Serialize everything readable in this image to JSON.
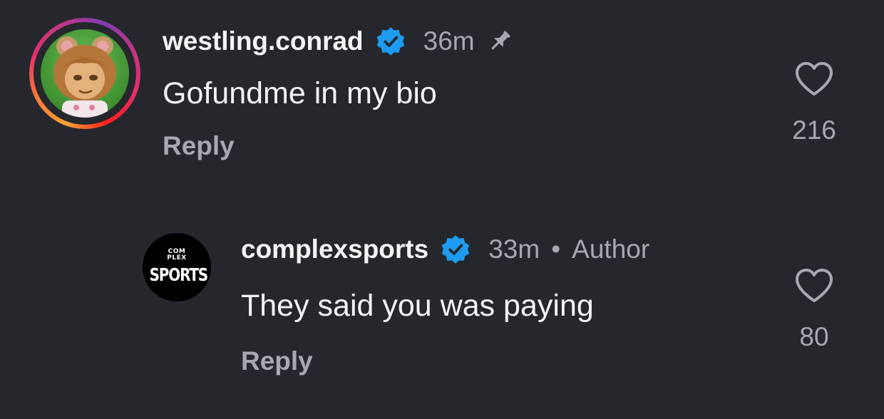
{
  "comments": [
    {
      "username": "westling.conrad",
      "time": "36m",
      "text": "Gofundme in my bio",
      "reply_label": "Reply",
      "likes": "216",
      "pinned": true,
      "verified": true
    },
    {
      "username": "complexsports",
      "time": "33m",
      "separator": "•",
      "badge_label": "Author",
      "text": "They said you was paying",
      "reply_label": "Reply",
      "likes": "80",
      "verified": true,
      "avatar_logo": {
        "line1": "COM",
        "line2": "PLEX",
        "line3": "SPORTS"
      }
    }
  ],
  "colors": {
    "background": "#25272c",
    "verified_badge": "#1d9bf0",
    "muted_text": "#a6a9b0",
    "primary_text": "#f3f4f6"
  },
  "icons": {
    "verified": "verified-badge-icon",
    "pin": "pin-icon",
    "like": "heart-outline-icon"
  }
}
